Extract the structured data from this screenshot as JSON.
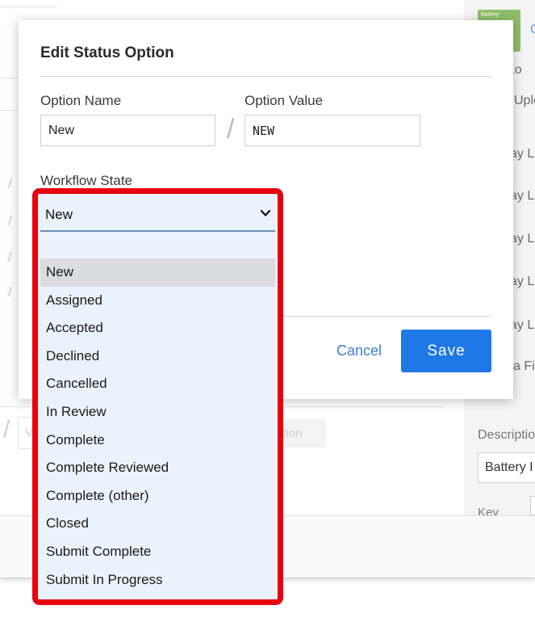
{
  "background": {
    "right_panel": {
      "thumbnail_label": "Battery",
      "link_fragment": "C",
      "row_fragments": [
        "t Lo",
        "Uple",
        "ay Li",
        "ay Li",
        "ay Li",
        "ay Li",
        "ay Li",
        "a Fie"
      ],
      "description_label": "Description",
      "description_value": "Battery I",
      "key_label": "Key"
    },
    "add_option_fragment": "ption",
    "value_input_fragment": "V"
  },
  "modal": {
    "title": "Edit Status Option",
    "option_name_label": "Option Name",
    "option_name_value": "New",
    "option_value_label": "Option Value",
    "option_value_value": "NEW",
    "separator": "/",
    "workflow_state_label": "Workflow State",
    "cancel_label": "Cancel",
    "save_label": "Save"
  },
  "workflow_dropdown": {
    "selected": "New",
    "options": [
      "New",
      "Assigned",
      "Accepted",
      "Declined",
      "Cancelled",
      "In Review",
      "Complete",
      "Complete Reviewed",
      "Complete (other)",
      "Closed",
      "Submit Complete",
      "Submit In Progress"
    ],
    "highlight_color": "#e8000f"
  },
  "colors": {
    "primary": "#1e78e6",
    "link": "#3b7dd8",
    "dropdown_bg": "#eaf2fb"
  }
}
